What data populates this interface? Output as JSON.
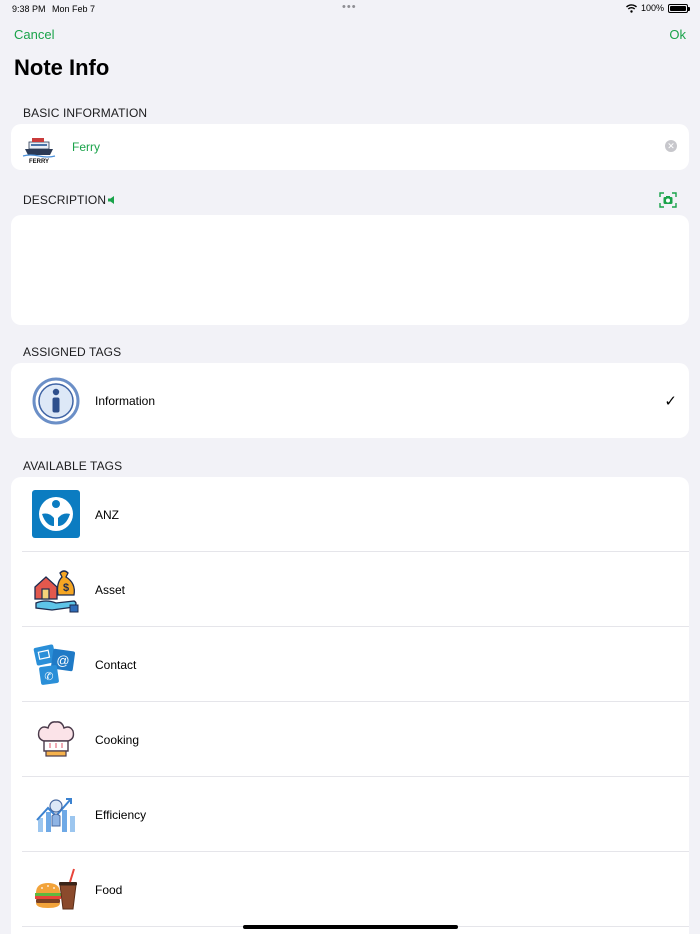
{
  "status_bar": {
    "time": "9:38 PM",
    "date": "Mon Feb 7",
    "dots": "•••",
    "battery": "100%"
  },
  "nav": {
    "cancel_label": "Cancel",
    "ok_label": "Ok",
    "title": "Note Info"
  },
  "sections": {
    "basic": "BASIC INFORMATION",
    "description": "DESCRIPTION",
    "assigned": "ASSIGNED TAGS",
    "available": "AVAILABLE TAGS"
  },
  "basic": {
    "name_value": "Ferry",
    "thumb_caption": "FERRY"
  },
  "description": {
    "value": ""
  },
  "assigned_tags": [
    {
      "label": "Information",
      "icon": "info-icon",
      "checked": true
    }
  ],
  "available_tags": [
    {
      "label": "ANZ",
      "icon": "anz-icon"
    },
    {
      "label": "Asset",
      "icon": "asset-icon"
    },
    {
      "label": "Contact",
      "icon": "contact-icon"
    },
    {
      "label": "Cooking",
      "icon": "chef-hat-icon"
    },
    {
      "label": "Efficiency",
      "icon": "efficiency-icon"
    },
    {
      "label": "Food",
      "icon": "food-icon"
    }
  ],
  "colors": {
    "accent": "#1aa34a",
    "background": "#f2f2f7",
    "card": "#ffffff"
  }
}
